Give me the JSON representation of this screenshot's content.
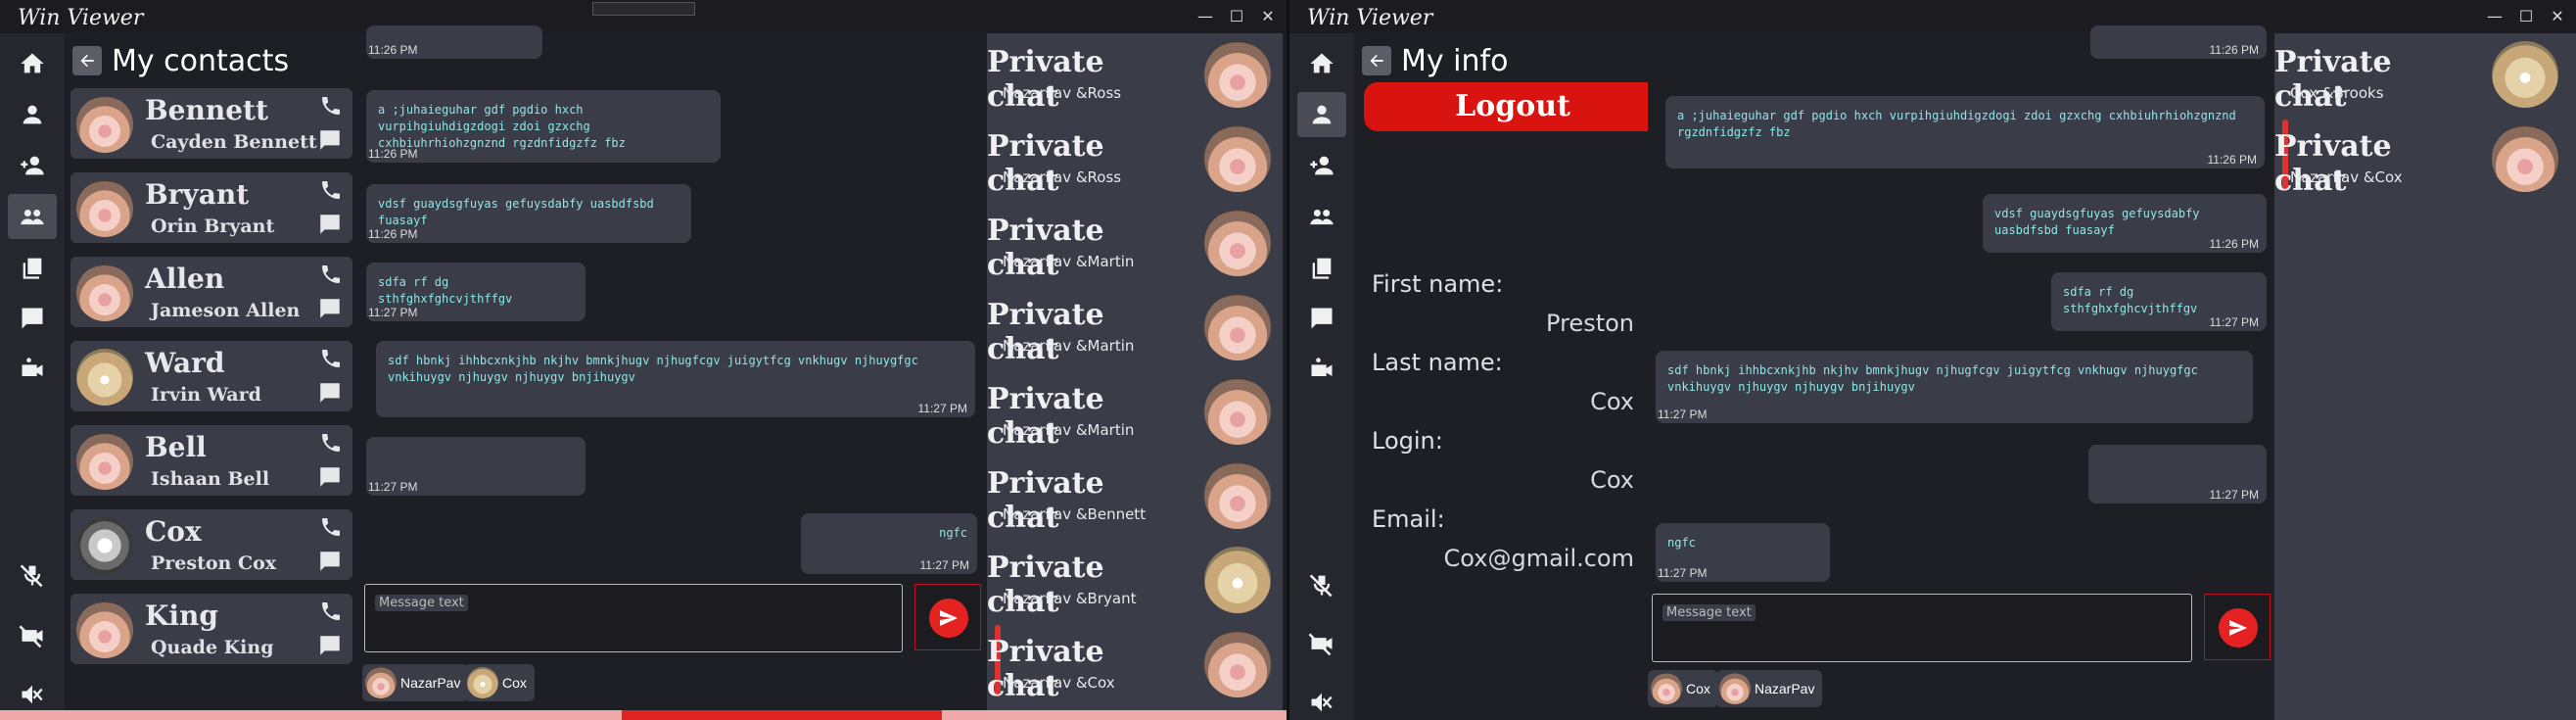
{
  "window_title": "Win Viewer",
  "window_controls": {
    "minimize": "—",
    "maximize": "☐",
    "close": "✕"
  },
  "left": {
    "panel_title": "My contacts",
    "contacts": [
      {
        "name": "Bennett",
        "full": "Cayden Bennett",
        "avatar": "hamster"
      },
      {
        "name": "Bryant",
        "full": "Orin Bryant",
        "avatar": "hamster"
      },
      {
        "name": "Allen",
        "full": "Jameson Allen",
        "avatar": "hamster"
      },
      {
        "name": "Ward",
        "full": "Irvin Ward",
        "avatar": "cat"
      },
      {
        "name": "Bell",
        "full": "Ishaan Bell",
        "avatar": "hamster"
      },
      {
        "name": "Cox",
        "full": "Preston Cox",
        "avatar": "cat2"
      },
      {
        "name": "King",
        "full": "Quade King",
        "avatar": "hamster"
      }
    ],
    "messages": [
      {
        "text": "",
        "time": "11:26 PM"
      },
      {
        "text": "a ;juhaieguhar gdf pgdio hxch vurpihgiuhdigzdogi zdoi gzxchg cxhbiuhrhiohzgnznd rgzdnfidgzfz fbz",
        "time": "11:26 PM"
      },
      {
        "text": "vdsf guaydsgfuyas gefuysdabfy uasbdfsbd fuasayf",
        "time": "11:26 PM"
      },
      {
        "text": "sdfa rf dg sthfghxfghcvjthffgv",
        "time": "11:27 PM"
      },
      {
        "text": "sdf hbnkj ihhbcxnkjhb nkjhv bmnkjhugv njhugfcgv juigytfcg vnkhugv njhuygfgc vnkihuygv njhuygv njhuygv bnjihuygv",
        "time": "11:27 PM"
      },
      {
        "text": "",
        "time": "11:27 PM"
      },
      {
        "text": "ngfc",
        "time": "11:27 PM"
      }
    ],
    "composer_placeholder": "Message text",
    "members": [
      "NazarPav",
      "Cox"
    ],
    "private_chats": [
      {
        "title": "Private chat",
        "sub": "NazarPav &Ross",
        "avatar": "hamster"
      },
      {
        "title": "Private chat",
        "sub": "NazarPav &Ross",
        "avatar": "hamster"
      },
      {
        "title": "Private chat",
        "sub": "NazarPav &Martin",
        "avatar": "hamster"
      },
      {
        "title": "Private chat",
        "sub": "NazarPav &Martin",
        "avatar": "hamster"
      },
      {
        "title": "Private chat",
        "sub": "NazarPav &Martin",
        "avatar": "hamster"
      },
      {
        "title": "Private chat",
        "sub": "NazarPav &Bennett",
        "avatar": "hamster"
      },
      {
        "title": "Private chat",
        "sub": "NazarPav &Bryant",
        "avatar": "cat"
      },
      {
        "title": "Private chat",
        "sub": "NazarPav &Cox",
        "avatar": "hamster",
        "selected": true
      }
    ],
    "progress": {
      "start": 0.483,
      "end": 0.732
    }
  },
  "right": {
    "panel_title": "My info",
    "logout_label": "Logout",
    "fields": [
      {
        "label": "First name:",
        "value": "Preston"
      },
      {
        "label": "Last name:",
        "value": "Cox"
      },
      {
        "label": "Login:",
        "value": "Cox"
      },
      {
        "label": "Email:",
        "value": "Cox@gmail.com"
      }
    ],
    "messages": [
      {
        "text": "",
        "time": "11:26 PM"
      },
      {
        "text": "a ;juhaieguhar gdf pgdio hxch vurpihgiuhdigzdogi zdoi gzxchg cxhbiuhrhiohzgnznd rgzdnfidgzfz fbz",
        "time": "11:26 PM"
      },
      {
        "text": "vdsf guaydsgfuyas gefuysdabfy uasbdfsbd fuasayf",
        "time": "11:26 PM"
      },
      {
        "text": "sdfa rf dg sthfghxfghcvjthffgv",
        "time": "11:27 PM"
      },
      {
        "text": "sdf hbnkj ihhbcxnkjhb nkjhv bmnkjhugv njhugfcgv juigytfcg vnkhugv njhuygfgc vnkihuygv njhuygv njhuygv bnjihuygv",
        "time": "11:27 PM"
      },
      {
        "text": "",
        "time": "11:27 PM"
      },
      {
        "text": "ngfc",
        "time": "11:27 PM"
      }
    ],
    "composer_placeholder": "Message text",
    "members": [
      "Cox",
      "NazarPav"
    ],
    "private_chats": [
      {
        "title": "Private chat",
        "sub": "Cox &Brooks",
        "avatar": "cat"
      },
      {
        "title": "Private chat",
        "sub": "NazarPav &Cox",
        "avatar": "hamster",
        "selected": true
      }
    ]
  },
  "icons": {
    "nav": [
      "home-icon",
      "profile-icon",
      "add-contact-icon",
      "contacts-icon",
      "copy-icon",
      "chat-icon",
      "video-call-icon",
      "mic-off-icon",
      "camera-off-icon",
      "sound-off-icon"
    ],
    "accent": "#e52222"
  }
}
